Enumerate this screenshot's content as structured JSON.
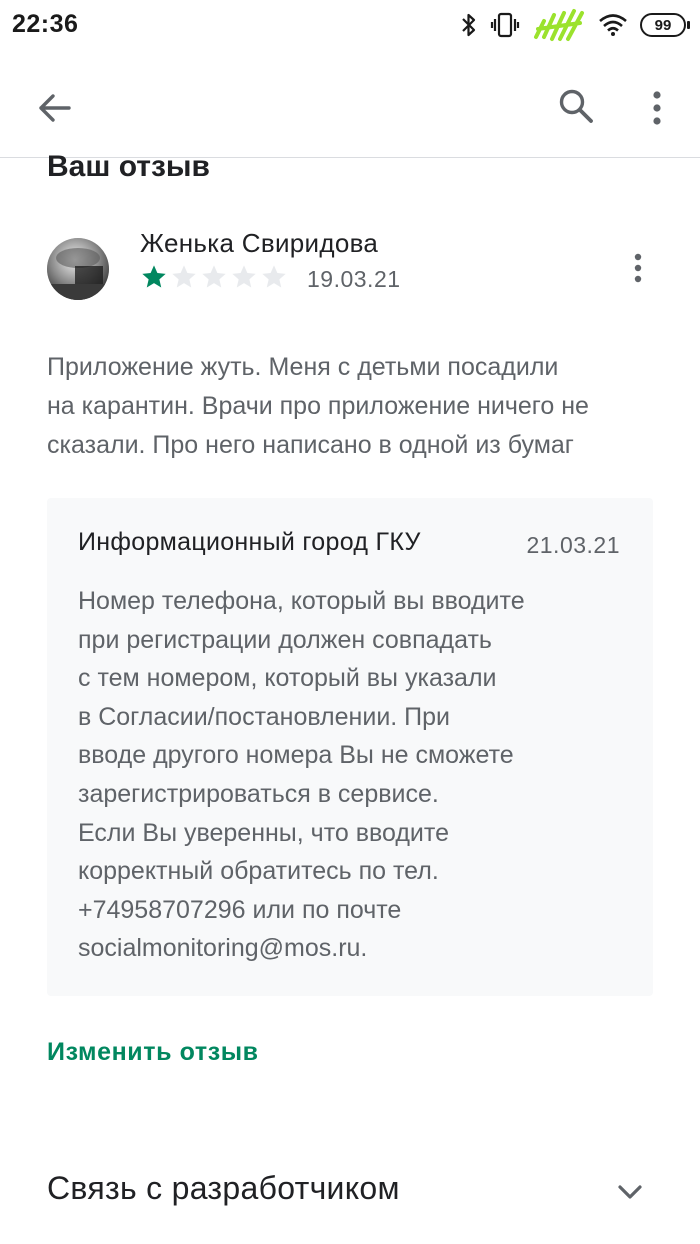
{
  "status_bar": {
    "time": "22:36",
    "battery": "99",
    "icons": [
      "bluetooth-icon",
      "vibrate-icon",
      "signal-icon",
      "wifi-icon",
      "battery-icon"
    ]
  },
  "app_bar": {
    "icons": [
      "back-arrow-icon",
      "search-icon",
      "more-vert-icon"
    ]
  },
  "section_title": "Ваш отзыв",
  "review": {
    "author": "Женька Свиридова",
    "rating": 1,
    "max_rating": 5,
    "date": "19.03.21",
    "text": "Приложение жуть. Меня с детьми посадили\nна карантин. Врачи про приложение ничего не\nсказали. Про него написано в одной из бумаг"
  },
  "reply": {
    "author": "Информационный город ГКУ",
    "date": "21.03.21",
    "text": "Номер телефона, который вы вводите\nпри регистрации должен совпадать\nс тем номером, который вы указали\nв Согласии/постановлении. При\nвводе другого номера Вы не сможете\nзарегистрироваться в сервисе.\nЕсли Вы уверенны, что вводите\nкорректный обратитесь по тел.\n+74958707296 или по почте\nsocialmonitoring@mos.ru."
  },
  "edit_review_label": "Изменить отзыв",
  "contact_developer_label": "Связь с разработчиком",
  "colors": {
    "accent": "#01875f",
    "star_filled": "#01875f",
    "star_empty": "#e8eaed",
    "reply_background": "#f8f9fa",
    "secondary_text": "#5f6368"
  }
}
